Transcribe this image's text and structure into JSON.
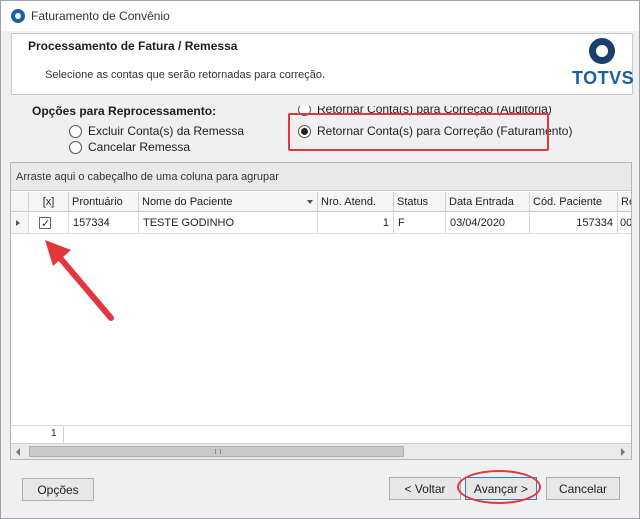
{
  "window": {
    "title": "Faturamento de Convênio"
  },
  "header": {
    "title": "Processamento de Fatura / Remessa",
    "subtitle": "Selecione as contas que serão retornadas para correção.",
    "logo_text": "TOTVS"
  },
  "options": {
    "title": "Opções para Reprocessamento:",
    "items": [
      {
        "label": "Excluir Conta(s) da Remessa",
        "checked": false
      },
      {
        "label": "Cancelar Remessa",
        "checked": false
      },
      {
        "label": "Retornar Conta(s) para Correção (Auditoria)",
        "checked": false
      },
      {
        "label": "Retornar Conta(s) para Correção (Faturamento)",
        "checked": true
      }
    ]
  },
  "grid": {
    "group_hint": "Arraste aqui o cabeçalho de uma coluna para agrupar",
    "columns": [
      "[x]",
      "Prontuário",
      "Nome do Paciente",
      "Nro. Atend.",
      "Status",
      "Data Entrada",
      "Cód. Paciente",
      "Re"
    ],
    "rows": [
      {
        "selected": true,
        "prontuario": "157334",
        "nome": "TESTE GODINHO",
        "atend": "1",
        "status": "F",
        "data_entrada": "03/04/2020",
        "cod_paciente": "157334",
        "re": "00"
      }
    ],
    "footer_count": "1"
  },
  "buttons": {
    "options": "Opções",
    "back": "< Voltar",
    "next": "Avançar >",
    "cancel": "Cancelar"
  },
  "colors": {
    "highlight": "#e0383c",
    "brand": "#1a5fa8"
  }
}
